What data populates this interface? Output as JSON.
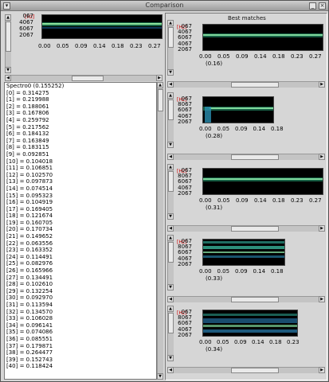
{
  "window": {
    "title": "Comparison"
  },
  "top_plot": {
    "unit": "[Hz]",
    "y_ticks": [
      "067",
      "4067",
      "6067",
      "2067"
    ],
    "x_ticks": [
      "0.00",
      "0.05",
      "0.09",
      "0.14",
      "0.18",
      "0.23",
      "0.27"
    ]
  },
  "matches": {
    "header": "Best matches",
    "items": [
      {
        "unit": "[Hz]",
        "y_ticks": [
          "067",
          "4067",
          "6067",
          "4067",
          "2067"
        ],
        "x_ticks": [
          "0.00",
          "0.05",
          "0.09",
          "0.14",
          "0.18",
          "0.23",
          "0.27"
        ],
        "score": "(0.16)"
      },
      {
        "unit": "[Hz]",
        "y_ticks": [
          "067",
          "8067",
          "6067",
          "4067",
          "2067"
        ],
        "x_ticks": [
          "0.00",
          "0.05",
          "0.09",
          "0.14",
          "0.18"
        ],
        "score": "(0.28)"
      },
      {
        "unit": "[Hz]",
        "y_ticks": [
          "067",
          "8067",
          "6067",
          "4067",
          "2067"
        ],
        "x_ticks": [
          "0.00",
          "0.05",
          "0.09",
          "0.14",
          "0.18",
          "0.23",
          "0.27"
        ],
        "score": "(0.31)"
      },
      {
        "unit": "[Hz]",
        "y_ticks": [
          "067",
          "8067",
          "6067",
          "4067",
          "2067"
        ],
        "x_ticks": [
          "0.00",
          "0.05",
          "0.09",
          "0.14",
          "0.18"
        ],
        "score": "(0.33)"
      },
      {
        "unit": "[Hz]",
        "y_ticks": [
          "067",
          "8067",
          "6067",
          "4067",
          "2067"
        ],
        "x_ticks": [
          "0.00",
          "0.05",
          "0.09",
          "0.14",
          "0.18",
          "0.23"
        ],
        "score": "(0.34)"
      }
    ]
  },
  "list": {
    "rows": [
      "Spectro0 (0.155252)",
      "[0] = 0.314275",
      "[1] = 0.219988",
      "[2] = 0.188061",
      "[3] = 0.167806",
      "[4] = 0.259792",
      "[5] = 0.217562",
      "[6] = 0.184132",
      "[7] = 0.163849",
      "[8] = 0.183115",
      "[9] = 0.092851",
      "[10] = 0.104018",
      "[11] = 0.106851",
      "[12] = 0.102570",
      "[13] = 0.097873",
      "[14] = 0.074514",
      "[15] = 0.095323",
      "[16] = 0.104919",
      "[17] = 0.169405",
      "[18] = 0.121674",
      "[19] = 0.160705",
      "[20] = 0.170734",
      "[21] = 0.149652",
      "[22] = 0.063556",
      "[23] = 0.163352",
      "[24] = 0.114491",
      "[25] = 0.082976",
      "[26] = 0.165966",
      "[27] = 0.134491",
      "[28] = 0.102610",
      "[29] = 0.132254",
      "[30] = 0.092970",
      "[31] = 0.113594",
      "[32] = 0.134570",
      "[33] = 0.106028",
      "[34] = 0.096141",
      "[35] = 0.074086",
      "[36] = 0.085551",
      "[37] = 0.179871",
      "[38] = 0.264477",
      "[39] = 0.152743",
      "[40] = 0.118424"
    ]
  },
  "icons": {
    "up": "▲",
    "down": "▼",
    "left": "◀",
    "right": "▶",
    "menu": "▾",
    "min": "_",
    "close": "×"
  }
}
